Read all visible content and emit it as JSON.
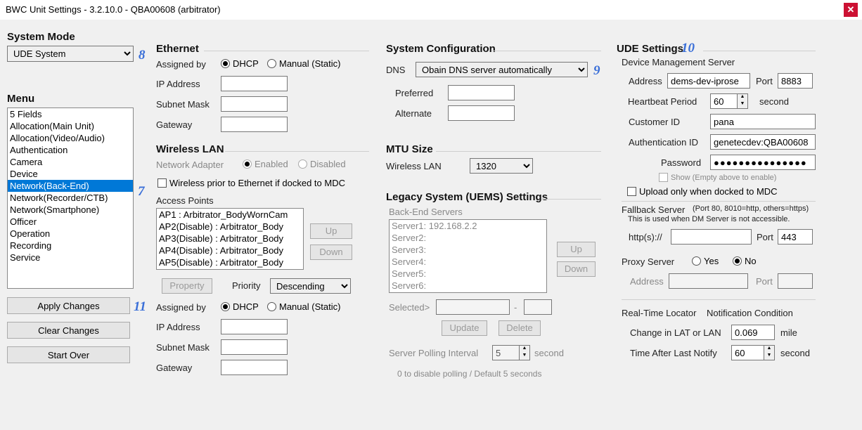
{
  "title": "BWC Unit Settings - 3.2.10.0 - QBA00608 (arbitrator)",
  "systemMode": {
    "label": "System Mode",
    "value": "UDE System"
  },
  "menu": {
    "label": "Menu",
    "items": [
      "5 Fields",
      "Allocation(Main Unit)",
      "Allocation(Video/Audio)",
      "Authentication",
      "Camera",
      "Device",
      "Network(Back-End)",
      "Network(Recorder/CTB)",
      "Network(Smartphone)",
      "Officer",
      "Operation",
      "Recording",
      "Service"
    ],
    "selected": "Network(Back-End)"
  },
  "buttons": {
    "apply": "Apply Changes",
    "clear": "Clear Changes",
    "startOver": "Start Over"
  },
  "ethernet": {
    "title": "Ethernet",
    "assignedBy": "Assigned by",
    "dhcp": "DHCP",
    "manual": "Manual (Static)",
    "ip": "IP Address",
    "subnet": "Subnet Mask",
    "gateway": "Gateway"
  },
  "wlan": {
    "title": "Wireless LAN",
    "adapter": "Network Adapter",
    "enabled": "Enabled",
    "disabled": "Disabled",
    "prior": "Wireless prior to Ethernet if docked to MDC",
    "apLabel": "Access Points",
    "aps": [
      "AP1 : Arbitrator_BodyWornCam",
      "AP2(Disable) : Arbitrator_Body",
      "AP3(Disable) : Arbitrator_Body",
      "AP4(Disable) : Arbitrator_Body",
      "AP5(Disable) : Arbitrator_Body"
    ],
    "up": "Up",
    "down": "Down",
    "property": "Property",
    "priority": "Priority",
    "priorityVal": "Descending",
    "assignedBy": "Assigned by",
    "dhcp": "DHCP",
    "manual": "Manual (Static)",
    "ip": "IP Address",
    "subnet": "Subnet Mask",
    "gateway": "Gateway"
  },
  "syscfg": {
    "title": "System Configuration",
    "dns": "DNS",
    "dnsVal": "Obain DNS server automatically",
    "preferred": "Preferred",
    "alternate": "Alternate"
  },
  "mtu": {
    "title": "MTU Size",
    "wlan": "Wireless LAN",
    "val": "1320"
  },
  "legacy": {
    "title": "Legacy System (UEMS) Settings",
    "backendLabel": "Back-End Servers",
    "servers": [
      "Server1: 192.168.2.2",
      "Server2:",
      "Server3:",
      "Server4:",
      "Server5:",
      "Server6:"
    ],
    "up": "Up",
    "down": "Down",
    "selected": "Selected>",
    "update": "Update",
    "delete": "Delete",
    "pollLabel": "Server Polling Interval",
    "pollVal": "5",
    "pollUnit": "second",
    "pollHint": "0 to disable polling / Default 5 seconds"
  },
  "ude": {
    "title": "UDE Settings",
    "dms": "Device Management Server",
    "address": "Address",
    "addressVal": "dems-dev-iprose",
    "port": "Port",
    "portVal": "8883",
    "heartbeat": "Heartbeat Period",
    "heartbeatVal": "60",
    "heartbeatUnit": "second",
    "custId": "Customer ID",
    "custIdVal": "pana",
    "authId": "Authentication ID",
    "authIdVal": "genetecdev:QBA00608",
    "password": "Password",
    "passwordVal": "●●●●●●●●●●●●●●●",
    "showHint": "Show (Empty above to enable)",
    "uploadDocked": "Upload only when docked to MDC",
    "fallback": "Fallback Server",
    "fallbackHint": "(Port 80, 8010=http, others=https)",
    "fallbackNote": "This is used when DM Server is not accessible.",
    "httpsPrefix": "http(s)://",
    "fallbackPort": "Port",
    "fallbackPortVal": "443",
    "proxy": "Proxy Server",
    "yes": "Yes",
    "no": "No",
    "proxyAddr": "Address",
    "proxyPort": "Port",
    "rtl": "Real-Time Locator",
    "notif": "Notification Condition",
    "change": "Change in LAT or LAN",
    "changeVal": "0.069",
    "mile": "mile",
    "timeAfter": "Time After Last Notify",
    "timeAfterVal": "60",
    "second": "second"
  },
  "callouts": {
    "c7": "7",
    "c8": "8",
    "c9": "9",
    "c10": "10",
    "c11": "11"
  }
}
